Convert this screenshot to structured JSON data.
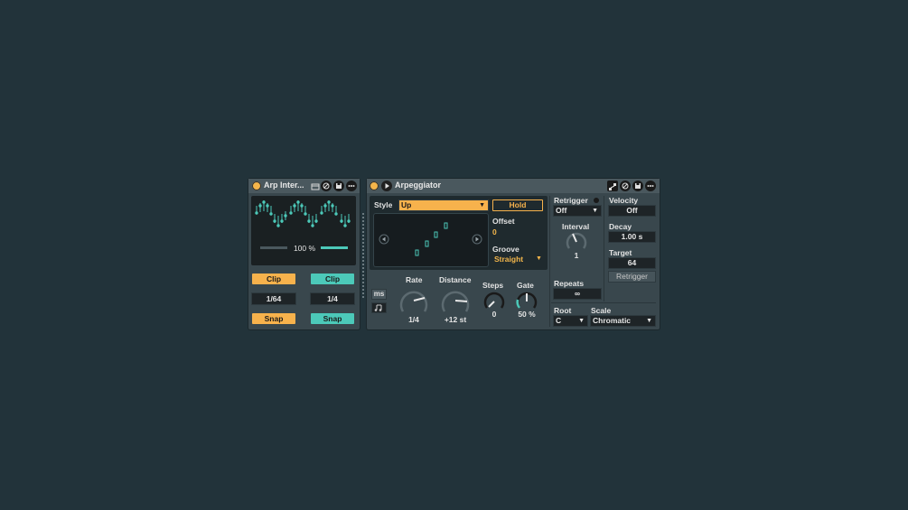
{
  "colors": {
    "orange": "#f7b24c",
    "teal": "#4cc9b9",
    "panel": "#39474d",
    "bg": "#22333a"
  },
  "device1": {
    "title": "Arp Inter...",
    "mix": "100 %",
    "left": {
      "mode": "Clip",
      "value": "1/64",
      "snap": "Snap"
    },
    "right": {
      "mode": "Clip",
      "value": "1/4",
      "snap": "Snap"
    },
    "icons": [
      "tab-icon",
      "hot-swap-icon",
      "save-icon",
      "more-icon"
    ]
  },
  "device2": {
    "title": "Arpeggiator",
    "style": {
      "label": "Style",
      "value": "Up"
    },
    "hold": "Hold",
    "offset": {
      "label": "Offset",
      "value": "0"
    },
    "groove": {
      "label": "Groove",
      "value": "Straight"
    },
    "rate": {
      "label": "Rate",
      "value": "1/4"
    },
    "distance": {
      "label": "Distance",
      "value": "+12 st"
    },
    "steps": {
      "label": "Steps",
      "value": "0"
    },
    "gate": {
      "label": "Gate",
      "value": "50 %",
      "fraction": 0.5
    },
    "unit_ms": "ms",
    "retrigger": {
      "label": "Retrigger",
      "value": "Off"
    },
    "interval": {
      "label": "Interval",
      "value": "1"
    },
    "repeats": {
      "label": "Repeats",
      "value": "∞"
    },
    "velocity": {
      "label": "Velocity",
      "value": "Off"
    },
    "decay": {
      "label": "Decay",
      "value": "1.00 s"
    },
    "target": {
      "label": "Target",
      "value": "64"
    },
    "retrigger_btn": "Retrigger",
    "root": {
      "label": "Root",
      "value": "C"
    },
    "scale": {
      "label": "Scale",
      "value": "Chromatic"
    },
    "icons": [
      "midi-map-icon",
      "hot-swap-icon",
      "save-icon",
      "more-icon"
    ]
  }
}
